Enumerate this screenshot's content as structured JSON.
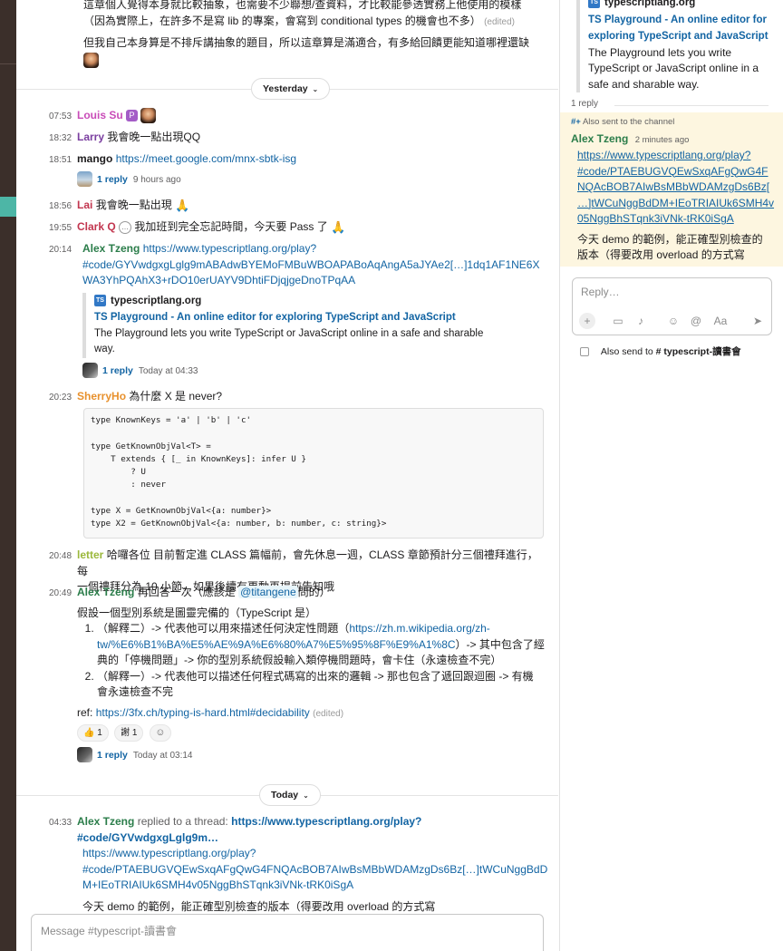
{
  "main": {
    "top_msg": {
      "line1": "這章個人覺得本身就比較抽象，也需要不少聯想/查資料，才比較能參透實務上他使用的模樣",
      "line2": "（因為實際上，在許多不是寫 lib 的專案，會寫到 conditional types 的機會也不多）",
      "edited": "(edited)",
      "line3": "但我自己本身算是不排斥講抽象的題目，所以這章算是滿適合，有多給回饋更能知道哪裡還缺"
    },
    "divider_yesterday": "Yesterday",
    "divider_today": "Today",
    "chevron": "⌄",
    "messages": [
      {
        "time": "07:53",
        "sender": "Louis Su",
        "color": "#c94cb8",
        "badge": "P"
      },
      {
        "time": "18:32",
        "sender": "Larry",
        "color": "#7b3fa0",
        "text": "我會晚一點出現QQ"
      },
      {
        "time": "18:51",
        "sender": "mango",
        "color": "#1d1c1d",
        "link": "https://meet.google.com/mnx-sbtk-isg",
        "reply": "1 reply",
        "reply_meta": "9 hours ago"
      },
      {
        "time": "18:56",
        "sender": "Lai",
        "color": "#c2364f",
        "text": "我會晚一點出現",
        "emoji": "🙏"
      },
      {
        "time": "19:55",
        "sender": "Clark Q",
        "color": "#c2364f",
        "text": "我加班到完全忘記時間，今天要 Pass 了",
        "emoji": "🙏",
        "icon": "…"
      },
      {
        "time": "20:14",
        "sender": "Alex Tzeng",
        "color": "#2b7d4a",
        "link_line1": "https://www.typescriptlang.org/play?",
        "link_line2": "#code/GYVwdgxgLglg9mABAdwBYEMoFMBuWBOAPABoAqAngA5aJYAe2[…]1dq1AF1NE6X",
        "link_line3": "WA3YhPQAhX3+rDO10erUAYV9DhtiFDjqjgeDnoTPqAA",
        "unfurl_site": "typescriptlang.org",
        "unfurl_title": "TS Playground - An online editor for exploring TypeScript and JavaScript",
        "unfurl_desc1": "The Playground lets you write TypeScript or JavaScript online in a safe and sharable",
        "unfurl_desc2": "way.",
        "reply": "1 reply",
        "reply_meta": "Today at 04:33"
      },
      {
        "time": "20:23",
        "sender": "SherryHo",
        "color": "#e8912d",
        "text": "為什麼 X 是 never?",
        "code": "type KnownKeys = 'a' | 'b' | 'c'\n\ntype GetKnownObjVal<T> =\n    T extends { [_ in KnownKeys]: infer U }\n        ? U\n        : never\n\ntype X = GetKnownObjVal<{a: number}>\ntype X2 = GetKnownObjVal<{a: number, b: number, c: string}>"
      },
      {
        "time": "20:48",
        "sender": "letter",
        "color": "#9bb83b",
        "text1": "哈囉各位 目前暫定進 CLASS 篇幅前，會先休息一週，CLASS 章節預計分三個禮拜進行，每",
        "text2": "一個禮拜分為 10 小節，如果後續有更動再提前告知哦"
      },
      {
        "time": "20:49",
        "sender": "Alex Tzeng",
        "color": "#2b7d4a",
        "text_pre": "再回答一次（應該是",
        "mention": "@titangene",
        "text_post": "問的）",
        "para": "假設一個型別系統是圖靈完備的（TypeScript 是）",
        "li1_pre": "（解釋二）-> 代表他可以用來描述任何決定性問題（",
        "li1_link1": "https://zh.m.wikipedia.org/zh-",
        "li1_link2": "tw/%E6%B1%BA%E5%AE%9A%E6%80%A7%E5%95%8F%E9%A1%8C",
        "li1_post": "）-> 其中包含了經",
        "li1_line3": "典的「停機問題」-> 你的型別系統假設輸入類停機問題時，會卡住（永遠檢查不完）",
        "li2_line1": "（解釋一）-> 代表他可以描述任何程式碼寫的出來的邏輯 -> 那也包含了遞回跟迴圈 -> 有機",
        "li2_line2": "會永遠檢查不完",
        "ref_label": "ref:",
        "ref_link": "https://3fx.ch/typing-is-hard.html#decidability",
        "edited": "(edited)",
        "reaction1_emoji": "👍",
        "reaction1_count": "1",
        "reaction2_emoji": "謝",
        "reaction2_count": "1",
        "reaction_add": "☺",
        "reply": "1 reply",
        "reply_meta": "Today at 03:14"
      },
      {
        "time": "04:33",
        "sender": "Alex Tzeng",
        "color": "#2b7d4a",
        "replied_text": "replied to a thread:",
        "replied_link": "https://www.typescriptlang.org/play?#code/GYVwdgxgLglg9m…",
        "link_line1": "https://www.typescriptlang.org/play?",
        "link_line2": "#code/PTAEBUGVQEwSxqAFgQwG4FNQAcBOB7AIwBsMBbWDAMzgDs6Bz[…]tWCuNggBdD",
        "link_line3": "M+IEoTRIAIUk6SMH4v05NggBhSTqnk3iVNk-tRK0iSgA",
        "text": "今天 demo 的範例，能正確型別檢查的版本（得要改用 overload 的方式寫"
      }
    ],
    "composer_placeholder": "Message #typescript-讀書會"
  },
  "thread": {
    "unfurl_site": "typescriptlang.org",
    "unfurl_title1": "TS Playground - An online editor for",
    "unfurl_title2": "exploring TypeScript and JavaScript",
    "unfurl_desc1": "The Playground lets you write",
    "unfurl_desc2": "TypeScript or JavaScript online in a",
    "unfurl_desc3": "safe and sharable way.",
    "reply_count": "1 reply",
    "also_sent": "Also sent to the channel",
    "also_sent_icon": "#+",
    "reply_sender": "Alex Tzeng",
    "reply_time": "2 minutes ago",
    "link1": "https://www.typescriptlang.org/play?",
    "link2": "#code/PTAEBUGVQEwSxqAFgQwG4F",
    "link3": "NQAcBOB7AIwBsMBbWDAMzgDs6Bz[",
    "link4": "…]tWCuNggBdDM+IEoTRIAIUk6SMH4v",
    "link5": "05NggBhSTqnk3iVNk-tRK0iSgA",
    "text1": "今天 demo 的範例，能正確型別檢查的",
    "text2": "版本（得要改用 overload 的方式寫",
    "reply_placeholder": "Reply…",
    "tb_plus": "+",
    "tb_video": "▭",
    "tb_mic": "♪",
    "tb_emoji": "☺",
    "tb_at": "@",
    "tb_format": "Aa",
    "tb_send": "➤",
    "also_send_label": "Also send to",
    "also_send_channel": "# typescript-讀書會"
  }
}
